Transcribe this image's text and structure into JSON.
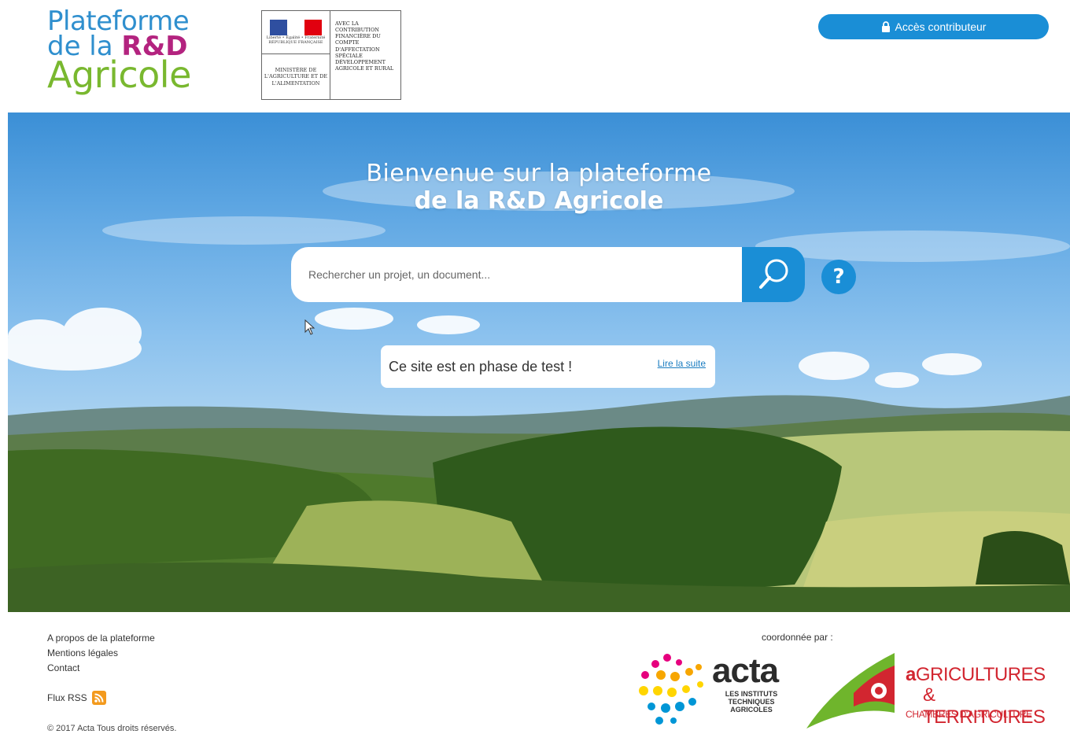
{
  "header": {
    "logo": {
      "line1": "Plateforme",
      "line2_a": "de la ",
      "line2_b": "R&D",
      "line3": "Agricole"
    },
    "ministry": {
      "motto": "Liberté • Égalité • Fraternité",
      "republic": "RÉPUBLIQUE FRANÇAISE",
      "ministry_name": "MINISTÈRE DE L'AGRICULTURE ET DE L'ALIMENTATION",
      "funding_text": "AVEC LA CONTRIBUTION FINANCIÈRE DU COMPTE D'AFFECTATION SPÉCIALE DÉVELOPPEMENT AGRICOLE ET RURAL"
    },
    "access_button": "Accès contributeur",
    "lock_icon": "lock-icon"
  },
  "hero": {
    "title_line1": "Bienvenue sur la plateforme",
    "title_line2": "de la R&D Agricole",
    "search_placeholder": "Rechercher un projet, un document...",
    "search_icon": "magnifier-icon",
    "help_label": "?",
    "notice_text": "Ce site est en phase de test !",
    "notice_link": "Lire la suite"
  },
  "footer": {
    "links": [
      "A propos de la plateforme",
      "Mentions légales",
      "Contact"
    ],
    "rss_label": "Flux RSS",
    "copyright": "© 2017 Acta Tous droits réservés.",
    "coordinated_by": "coordonnée par :",
    "acta": {
      "word": "acta",
      "sub": "LES INSTITUTS TECHNIQUES AGRICOLES"
    },
    "territoires": {
      "line1_a": "a",
      "line1_b": "GRICULTURES",
      "line2": "& TERRITOIRES",
      "line3": "CHAMBRES D'AGRICULTURE"
    }
  },
  "colors": {
    "accent": "#1a8ed6",
    "logo_blue": "#2f8fce",
    "logo_purple": "#b3237f",
    "logo_green": "#79b82f",
    "terr_red": "#d22630"
  }
}
